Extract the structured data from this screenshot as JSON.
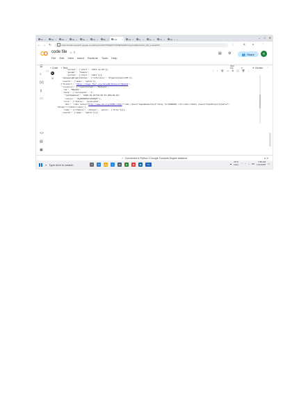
{
  "browser": {
    "tabs": [
      {
        "label": "Sy"
      },
      {
        "label": "Ne"
      },
      {
        "label": "Ne"
      },
      {
        "label": "Ne"
      },
      {
        "label": "Ne"
      },
      {
        "label": "Ne"
      },
      {
        "label": "Be"
      },
      {
        "label": "cod"
      },
      {
        "label": "HT"
      },
      {
        "label": "ht"
      },
      {
        "label": "ne"
      },
      {
        "label": "Ol"
      },
      {
        "label": "Ne"
      }
    ],
    "active_tab_index": 7,
    "window_controls": [
      "–",
      "□",
      "✕"
    ],
    "url": "https://colab.research.google.com/drive/1V4OSYfbNQ0T1z9PZfc9xRFbVLgzGIHjNmVN1v_l0C_Lwsqn#27"
  },
  "colab": {
    "title": "code file",
    "menu": [
      "File",
      "Edit",
      "View",
      "Insert",
      "Runtime",
      "Tools",
      "Help"
    ],
    "share_label": "Share",
    "avatar_letter": "R",
    "toolbar": {
      "code_label": "+ Code",
      "text_label": "+ Text",
      "ram_label": "RAM",
      "disk_label": "Disk",
      "gemini_label": "Gemini"
    },
    "cell": {
      "output_lines": [
        {
          "text": "        'period': {'start': '1974-12-25'}},",
          "link": ""
        },
        {
          "text": "        'gender': 'female',",
          "link": ""
        },
        {
          "text": "        'period': {'start': '2011'}}],",
          "link": ""
        },
        {
          "text": "    'managingOrganization': {'reference': 'Organization/235'}},",
          "link": ""
        },
        {
          "text": "    'search': {'mode': 'match'}},",
          "link": ""
        },
        {
          "text": "   {'fullUrl': '",
          "link": "https://hapi.fhir.org/baseR4/Patient/594431",
          "after": "',"
        },
        {
          "text": "    'resource': {'resourceType': 'Patient',",
          "link": ""
        },
        {
          "text": "     'id': '594431',",
          "link": ""
        },
        {
          "text": "     'meta': {'versionId': '1',",
          "link": ""
        },
        {
          "text": "      'lastUpdated': '2020-01-01T10:00:53.050+00:00',",
          "link": ""
        },
        {
          "text": "      'source': '#gHX5WSYGTnPm5Q77'},",
          "link": ""
        },
        {
          "text": "     'text': {'status': 'generated',",
          "link": ""
        },
        {
          "text": "      'div': '<div xmlns=\"",
          "link": "http://www.w3.org/1999/xhtml",
          "after": "\"><div class=\"hapiHeaderText\">Gray <b>JUNIPER </b></div><table class=\"hapiPropertyTable\">"
        },
        {
          "text": "<tbody/></table></div>'},",
          "link": ""
        },
        {
          "text": "     'name': [{'family': 'Juniper', 'given': ['Gray']}]},",
          "link": ""
        },
        {
          "text": "    'search': {'mode': 'match'}}]}",
          "link": ""
        }
      ]
    },
    "status": {
      "text": "Connected to Python 3 Google Compute Engine backend"
    }
  },
  "taskbar": {
    "search_placeholder": "Type here to search",
    "temperature": "26°C",
    "weather": "Haze",
    "time": "7:56 AM",
    "date": "1/11/2025",
    "lang": "EN"
  }
}
